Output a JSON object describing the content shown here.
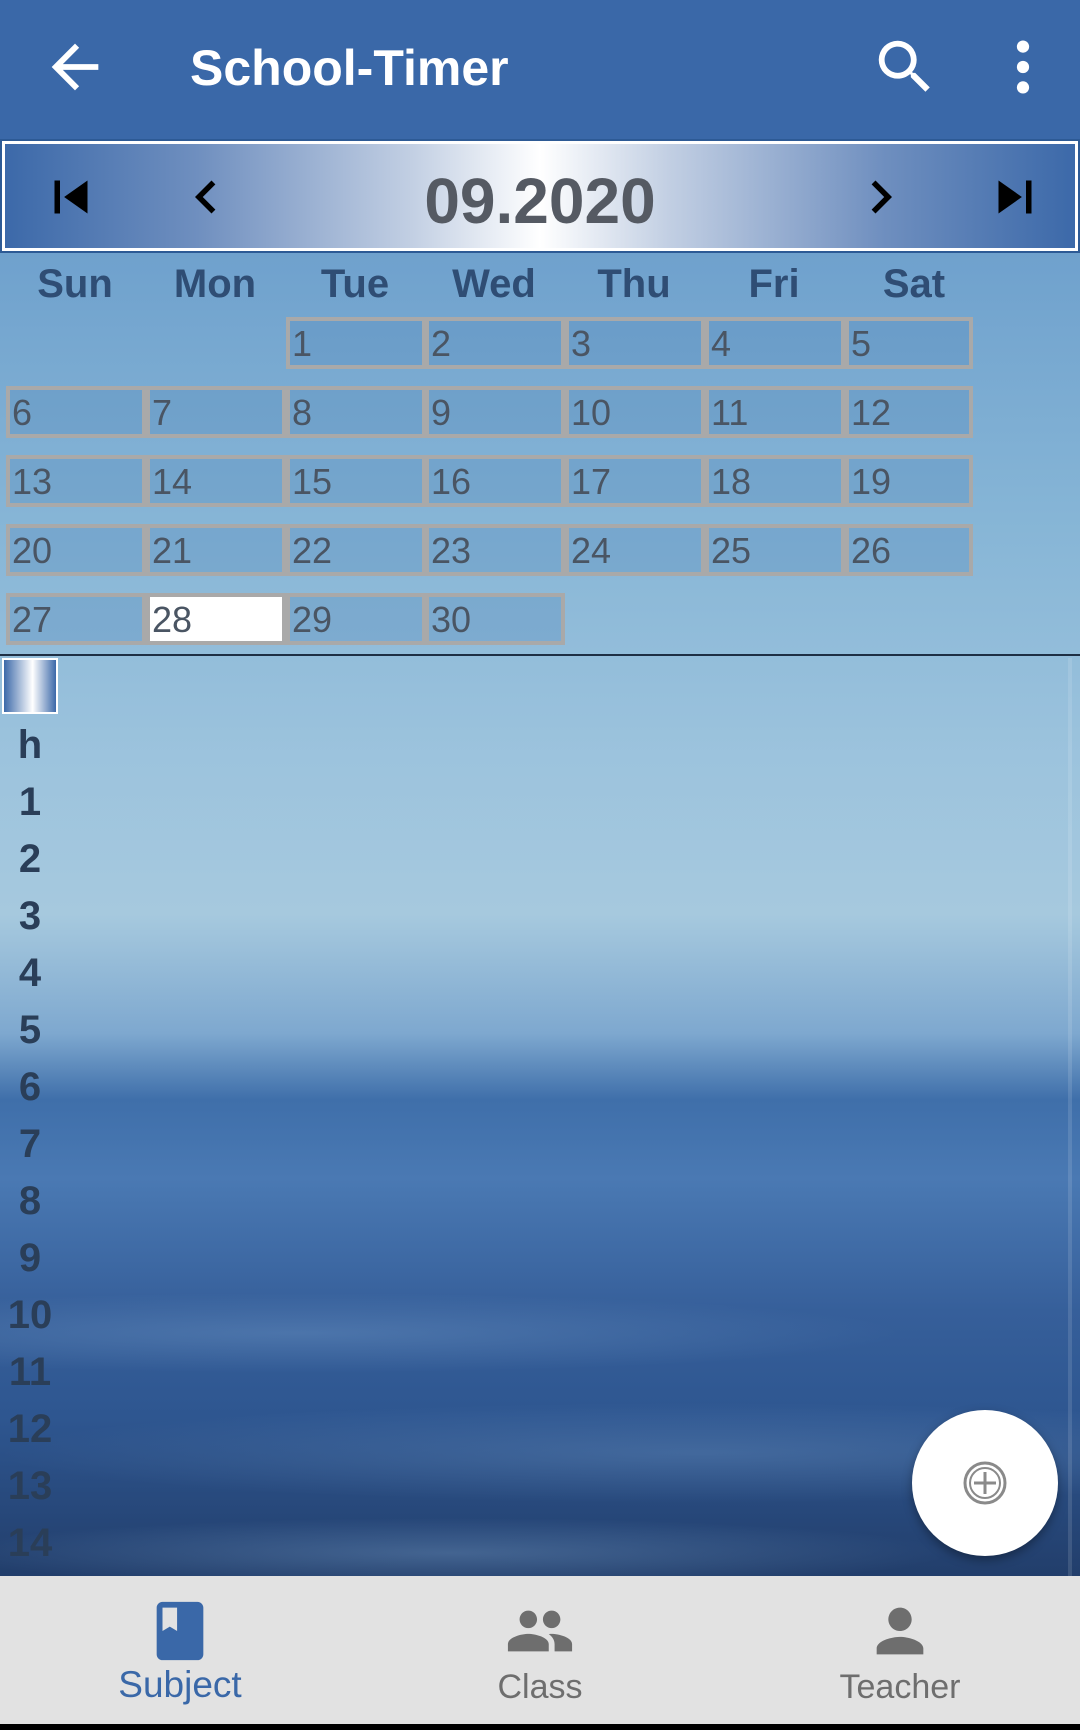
{
  "appbar": {
    "title": "School-Timer",
    "back_icon": "arrow-left-icon",
    "search_icon": "search-icon",
    "more_icon": "more-vert-icon",
    "color": "#3a68a8"
  },
  "monthbar": {
    "label": "09.2020",
    "first_icon": "skip-first-icon",
    "prev_icon": "chevron-left-icon",
    "next_icon": "chevron-right-icon",
    "last_icon": "skip-last-icon"
  },
  "calendar": {
    "weekdays": [
      "Sun",
      "Mon",
      "Tue",
      "Wed",
      "Thu",
      "Fri",
      "Sat"
    ],
    "first_weekday_index": 2,
    "days_in_month": 30,
    "today": 28
  },
  "timetable": {
    "header": "h",
    "hours": [
      "1",
      "2",
      "3",
      "4",
      "5",
      "6",
      "7",
      "8",
      "9",
      "10",
      "11",
      "12",
      "13",
      "14"
    ]
  },
  "fab": {
    "icon": "add-circle-icon"
  },
  "bottom_nav": {
    "active_color": "#3a68a8",
    "tabs": [
      {
        "label": "Subject",
        "icon": "book-icon",
        "active": true
      },
      {
        "label": "Class",
        "icon": "group-icon",
        "active": false
      },
      {
        "label": "Teacher",
        "icon": "person-icon",
        "active": false
      }
    ]
  }
}
